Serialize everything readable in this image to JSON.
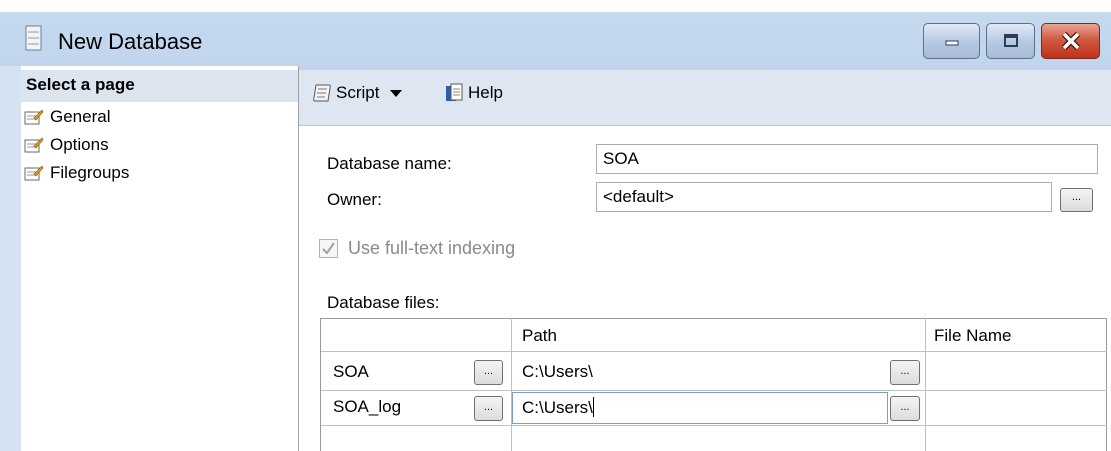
{
  "window": {
    "title": "New Database"
  },
  "sidebar": {
    "header": "Select a page",
    "items": [
      {
        "label": "General",
        "selected": true
      },
      {
        "label": "Options",
        "selected": false
      },
      {
        "label": "Filegroups",
        "selected": false
      }
    ]
  },
  "toolbar": {
    "script_label": "Script",
    "help_label": "Help"
  },
  "form": {
    "database_name_label": "Database name:",
    "database_name_value": "SOA",
    "owner_label": "Owner:",
    "owner_value": "<default>",
    "owner_browse_label": "...",
    "fulltext_label": "Use full-text indexing",
    "fulltext_checked": true,
    "fulltext_enabled": false
  },
  "files": {
    "label": "Database files:",
    "columns": [
      "",
      "Path",
      "File Name"
    ],
    "rows": [
      {
        "logical_name": "SOA",
        "button": "...",
        "path": "C:\\Users\\",
        "path_button": "...",
        "file_name": ""
      },
      {
        "logical_name": "SOA_log",
        "button": "...",
        "path": "C:\\Users\\",
        "path_button": "...",
        "file_name": ""
      }
    ]
  }
}
